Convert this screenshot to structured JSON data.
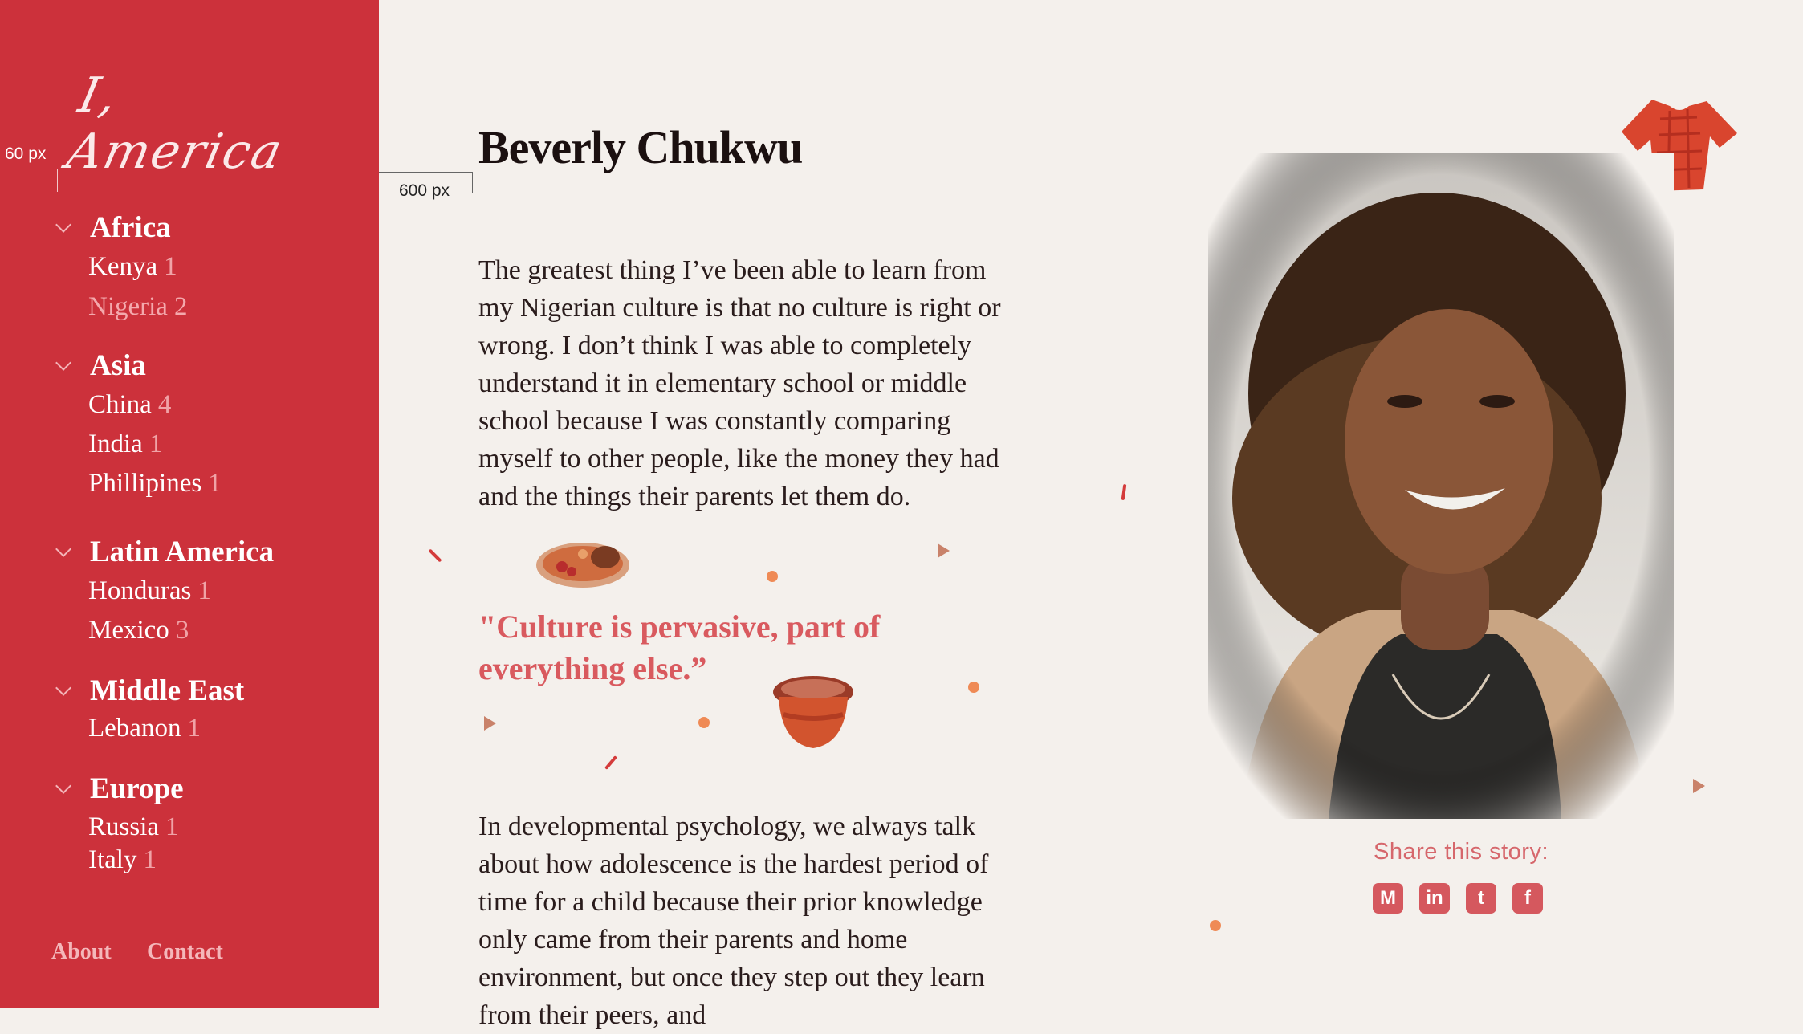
{
  "app": {
    "logo_text": "I, America"
  },
  "annotations": {
    "sidebar_margin": "60 px",
    "content_width": "600 px"
  },
  "sidebar": {
    "regions": [
      {
        "label": "Africa",
        "countries": [
          {
            "name": "Kenya",
            "count": "1"
          },
          {
            "name": "Nigeria",
            "count": "2",
            "active": true
          }
        ]
      },
      {
        "label": "Asia",
        "countries": [
          {
            "name": "China",
            "count": "4"
          },
          {
            "name": "India",
            "count": "1"
          },
          {
            "name": "Phillipines",
            "count": "1"
          }
        ]
      },
      {
        "label": "Latin America",
        "countries": [
          {
            "name": "Honduras",
            "count": "1"
          },
          {
            "name": "Mexico",
            "count": "3"
          }
        ]
      },
      {
        "label": "Middle East",
        "countries": [
          {
            "name": "Lebanon",
            "count": "1"
          }
        ]
      },
      {
        "label": "Europe",
        "countries": [
          {
            "name": "Russia",
            "count": "1"
          },
          {
            "name": "Italy",
            "count": "1"
          }
        ]
      }
    ],
    "footer": {
      "about": "About",
      "contact": "Contact"
    }
  },
  "story": {
    "name": "Beverly Chukwu",
    "paragraph_1": "The greatest thing I’ve been able to learn from my Nigerian culture is that no culture is right or wrong. I don’t think I was able to completely understand it in elementary school or middle school because I was constantly comparing myself to other people, like the money they had and the things their parents let them do.",
    "quote": "\"Culture is pervasive, part of everything else.”",
    "paragraph_2": "In developmental psychology, we always talk about how adolescence is the hardest period of time for a child because their prior knowledge only came from their parents and home environment, but once they step out they learn from their peers, and"
  },
  "share": {
    "label": "Share this story:",
    "icons": [
      "medium-icon",
      "linkedin-icon",
      "twitter-icon",
      "facebook-icon"
    ]
  },
  "colors": {
    "sidebar": "#cc313b",
    "background": "#f4f0ec",
    "quote": "#d95a5f",
    "accent_dot": "#ef8a55"
  }
}
